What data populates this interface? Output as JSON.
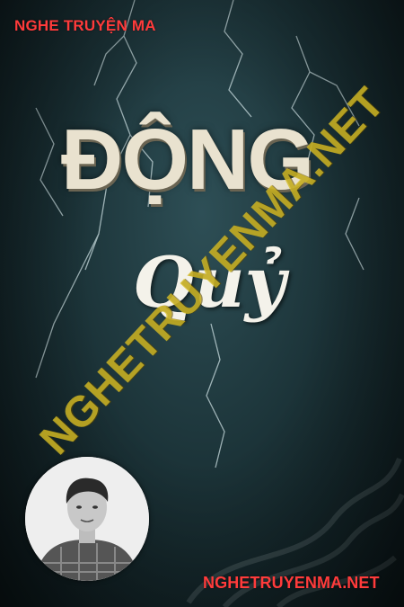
{
  "cover": {
    "site_top": "NGHE TRUYỆN MA",
    "title_main": "ĐỘNG",
    "title_script": "Quỷ",
    "watermark": "NGHETRUYENMA.NET",
    "site_bottom": "NGHETRUYENMA.NET"
  },
  "colors": {
    "brand_red": "#ff3b3b",
    "watermark_yellow": "#d6be28",
    "background": "#1c3439"
  }
}
